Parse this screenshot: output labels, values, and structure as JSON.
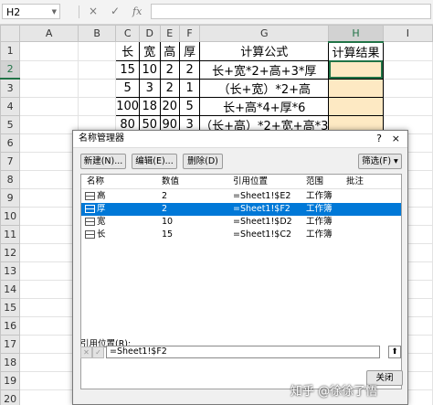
{
  "formula_bar": {
    "name_box": "H2",
    "cancel_glyph": "×",
    "enter_glyph": "✓",
    "fx": "fx",
    "formula": ""
  },
  "grid": {
    "columns": [
      "A",
      "B",
      "C",
      "D",
      "E",
      "F",
      "G",
      "H",
      "I"
    ],
    "rows": [
      "1",
      "2",
      "3",
      "4",
      "5",
      "6",
      "7",
      "8",
      "9",
      "10",
      "11",
      "12",
      "13",
      "14",
      "15",
      "16",
      "17",
      "18",
      "19",
      "20"
    ],
    "header": [
      "长",
      "宽",
      "高",
      "厚",
      "计算公式",
      "计算结果"
    ],
    "data": [
      [
        "15",
        "10",
        "2",
        "2",
        "长+宽*2+高+3*厚",
        ""
      ],
      [
        "5",
        "3",
        "2",
        "1",
        "（长+宽）*2+高",
        ""
      ],
      [
        "100",
        "18",
        "20",
        "5",
        "长+高*4+厚*6",
        ""
      ],
      [
        "80",
        "50",
        "90",
        "3",
        "（长+高）*2+宽+高*3",
        ""
      ]
    ]
  },
  "dialog": {
    "title": "名称管理器",
    "help": "?",
    "close": "×",
    "buttons": {
      "new": "新建(N)...",
      "edit": "编辑(E)...",
      "delete": "删除(D)",
      "filter": "筛选(F) ▾"
    },
    "columns": [
      "名称",
      "数值",
      "引用位置",
      "范围",
      "批注"
    ],
    "names": [
      {
        "name": "高",
        "value": "2",
        "refers_to": "=Sheet1!$E2",
        "scope": "工作簿",
        "comment": ""
      },
      {
        "name": "厚",
        "value": "2",
        "refers_to": "=Sheet1!$F2",
        "scope": "工作簿",
        "comment": ""
      },
      {
        "name": "宽",
        "value": "10",
        "refers_to": "=Sheet1!$D2",
        "scope": "工作簿",
        "comment": ""
      },
      {
        "name": "长",
        "value": "15",
        "refers_to": "=Sheet1!$C2",
        "scope": "工作簿",
        "comment": ""
      }
    ],
    "selected_index": 1,
    "refers_to_label": "引用位置(R):",
    "refers_to_value": "=Sheet1!$F2",
    "close_button": "关闭"
  },
  "watermark": "知乎 @徐徐了悟"
}
